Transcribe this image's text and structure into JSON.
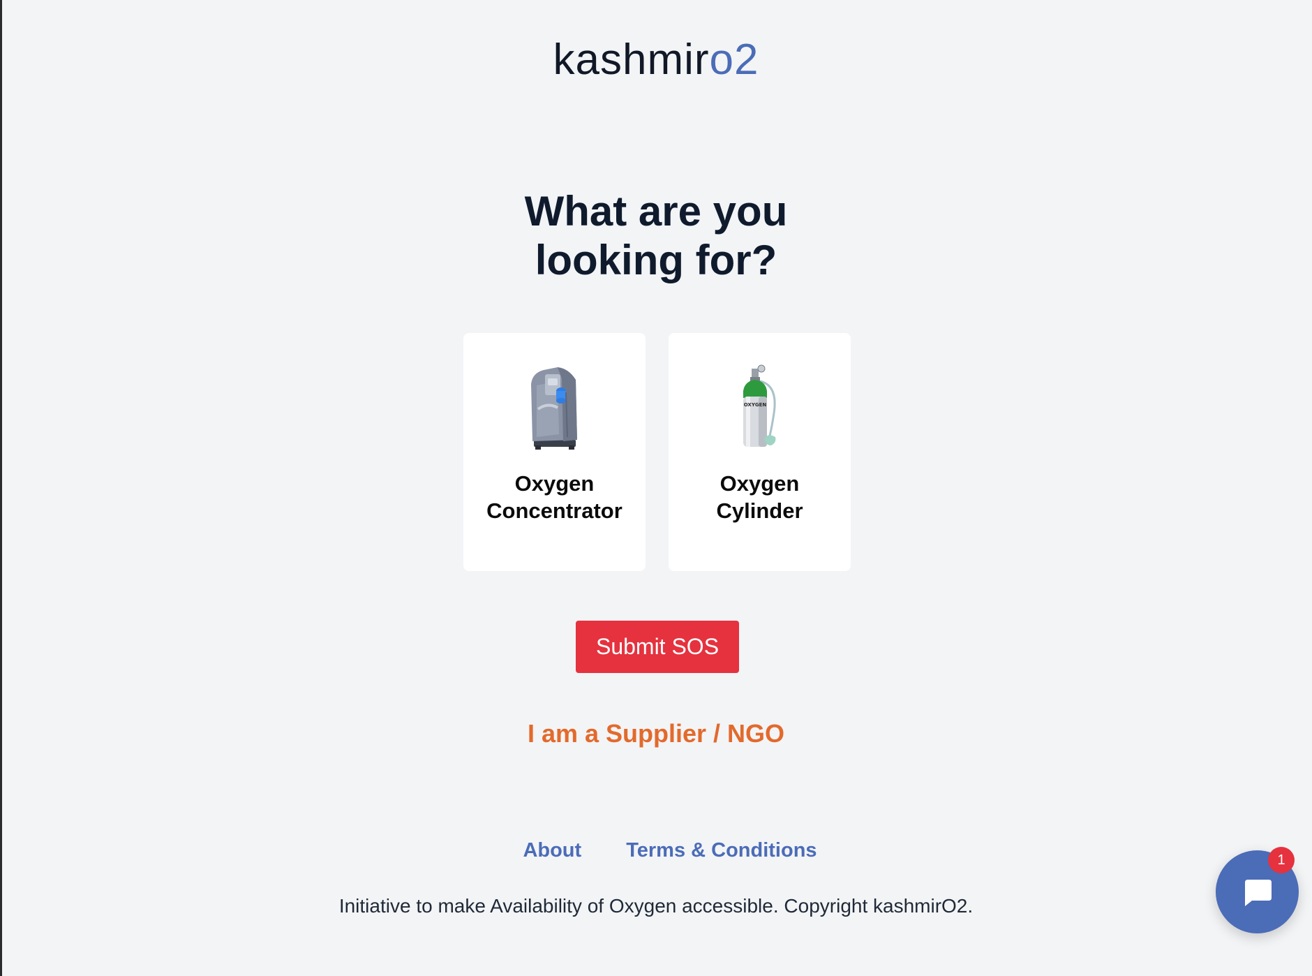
{
  "brand": {
    "name_main": "kashmir",
    "name_accent": "o2",
    "accent_color": "#4b6cb7"
  },
  "headline": {
    "line1": "What are you",
    "line2": "looking for?"
  },
  "options": [
    {
      "icon": "oxygen-concentrator-icon",
      "label_line1": "Oxygen",
      "label_line2": "Concentrator"
    },
    {
      "icon": "oxygen-cylinder-icon",
      "label_line1": "Oxygen",
      "label_line2": "Cylinder",
      "cylinder_text": "OXYGEN"
    }
  ],
  "actions": {
    "sos_label": "Submit SOS",
    "sos_color": "#e5323e",
    "supplier_label": "I am a Supplier / NGO",
    "supplier_color": "#e26a2c"
  },
  "footer": {
    "links": [
      "About",
      "Terms & Conditions"
    ],
    "copyright": "Initiative to make Availability of Oxygen accessible. Copyright kashmirO2."
  },
  "chat": {
    "icon": "chat-bubble-icon",
    "badge_count": "1"
  }
}
